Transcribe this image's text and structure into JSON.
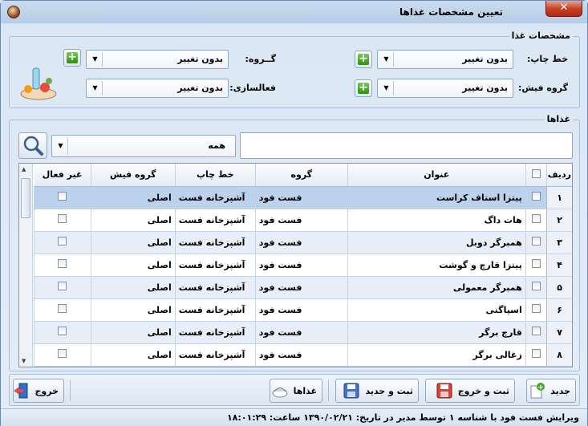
{
  "window": {
    "title": "تعیین مشخصات غذاها",
    "close_label": "✕"
  },
  "specs": {
    "title": "مشخصات غذا",
    "print_line_label": "خط چاپ:",
    "print_line_value": "بدون تغییر",
    "group_label": "گــروه:",
    "group_value": "بدون تغییر",
    "fish_group_label": "گروه فیش:",
    "fish_group_value": "بدون تغییر",
    "activation_label": "فعالسازی:",
    "activation_value": "بدون تغییر"
  },
  "foods": {
    "title": "غذاها",
    "search_value": "",
    "filter_value": "همه",
    "columns": {
      "row": "ردیف",
      "title": "عنوان",
      "group": "گروه",
      "print_line": "خط چاپ",
      "fish_group": "گروه فیش",
      "inactive": "غیر فعال"
    },
    "rows": [
      {
        "n": "۱",
        "name": "پیتزا استاف کراست",
        "group": "فست فود",
        "print": "آشپزخانه فست",
        "fish": "اصلی"
      },
      {
        "n": "۲",
        "name": "هات داگ",
        "group": "فست فود",
        "print": "آشپزخانه فست",
        "fish": "اصلی"
      },
      {
        "n": "۳",
        "name": "همبرگر دوبل",
        "group": "فست فود",
        "print": "آشپزخانه فست",
        "fish": "اصلی"
      },
      {
        "n": "۴",
        "name": "پیتزا قارچ و گوشت",
        "group": "فست فود",
        "print": "آشپزخانه فست",
        "fish": "اصلی"
      },
      {
        "n": "۵",
        "name": "همبرگر معمولی",
        "group": "فست فود",
        "print": "آشپزخانه فست",
        "fish": "اصلی"
      },
      {
        "n": "۶",
        "name": "اسپاگتی",
        "group": "فست فود",
        "print": "آشپزخانه فست",
        "fish": "اصلی"
      },
      {
        "n": "۷",
        "name": "قارچ برگر",
        "group": "فست فود",
        "print": "آشپزخانه فست",
        "fish": "اصلی"
      },
      {
        "n": "۸",
        "name": "زغالی برگر",
        "group": "فست فود",
        "print": "آشپزخانه فست",
        "fish": "اصلی"
      }
    ]
  },
  "toolbar": {
    "new_label": "جدید",
    "save_exit_label": "ثبت و خروج",
    "save_new_label": "ثبت و جدید",
    "foods_label": "غذاها",
    "exit_label": "خروج"
  },
  "status": {
    "text": "ویرایش فست فود با شناسه ۱ توسط مدیر در تاریخ: ۱۳۹۰/۰۲/۲۱ ساعت: ۱۸:۰۱:۲۹"
  },
  "colors": {
    "selected_row": "#bcd1ec",
    "alt_row": "#e8eef7",
    "plus_green": "#2f8f14"
  }
}
